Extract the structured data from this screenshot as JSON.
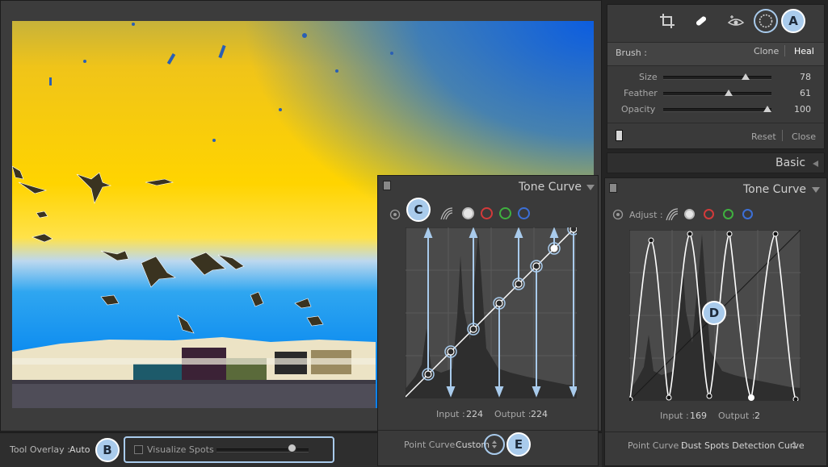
{
  "toolbar": {
    "tool_overlay_label": "Tool Overlay :",
    "tool_overlay_value": "Auto",
    "visualize_spots_label": "Visualize Spots",
    "visualize_spots_checked": false,
    "threshold_level": 0.85
  },
  "spot_tool": {
    "tools": [
      "crop-icon",
      "spot-removal-icon",
      "red-eye-icon",
      "dust-spot-icon"
    ],
    "brush_label": "Brush :",
    "clone_label": "Clone",
    "heal_label": "Heal",
    "sliders": [
      {
        "label": "Size",
        "value": "78",
        "level": 0.78
      },
      {
        "label": "Feather",
        "value": "61",
        "level": 0.61
      },
      {
        "label": "Opacity",
        "value": "100",
        "level": 1.0
      }
    ],
    "reset_label": "Reset",
    "close_label": "Close"
  },
  "basic_panel": {
    "title": "Basic"
  },
  "tone_curve_overlay": {
    "title": "Tone Curve",
    "input_label": "Input :",
    "input_value": "224",
    "output_label": "Output :",
    "output_value": "224",
    "point_curve_label": "Point Curve :",
    "point_curve_value": "Custom"
  },
  "tone_curve_panel": {
    "title": "Tone Curve",
    "adjust_label": "Adjust :",
    "input_label": "Input :",
    "input_value": "169",
    "output_label": "Output :",
    "output_value": "2",
    "point_curve_label": "Point Curve :",
    "point_curve_value": "Dust Spots Detection Curve"
  },
  "channel_colors": {
    "white": "#e6e6e6",
    "red": "#d23a3a",
    "green": "#3fb03f",
    "blue": "#3c6fd6"
  },
  "accent_color": "#a9cbec",
  "callouts": {
    "a": "A",
    "b": "B",
    "c": "C",
    "d": "D",
    "e": "E"
  }
}
